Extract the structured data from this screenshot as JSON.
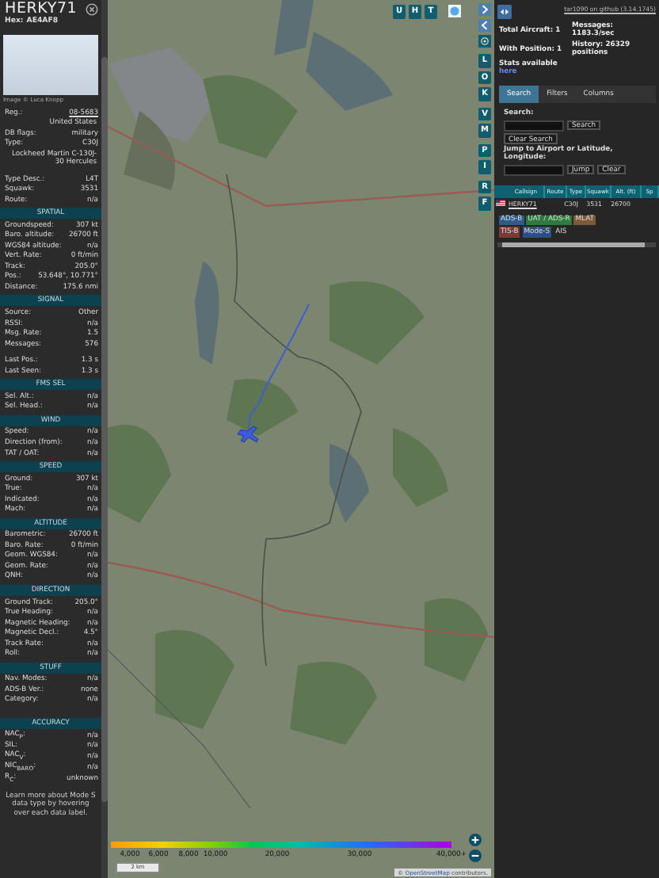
{
  "aircraft_panel": {
    "callsign": "HERKY71",
    "hex_label": "Hex:",
    "hex": "AE4AF8",
    "photo_credit": "Image © Luca Knopp",
    "details": [
      {
        "kind": "link",
        "label": "Reg.:",
        "value": "08-5683"
      },
      {
        "kind": "value",
        "value": "United States"
      },
      {
        "kind": "field",
        "label": "DB flags:",
        "value": "military"
      },
      {
        "kind": "field",
        "label": "Type:",
        "value": "C30J"
      },
      {
        "kind": "value",
        "value": "Lockheed Martin C-130J-30 Hercules"
      },
      {
        "kind": "field",
        "label": "Type Desc.:",
        "value": "L4T"
      },
      {
        "kind": "field",
        "label": "Squawk:",
        "value": "3531"
      },
      {
        "kind": "field",
        "label": "Route:",
        "value": "n/a"
      }
    ],
    "sections": [
      {
        "title": "SPATIAL",
        "rows": [
          {
            "label": "Groundspeed:",
            "value": "307 kt"
          },
          {
            "label": "Baro. altitude:",
            "value": "26700 ft"
          },
          {
            "label": "WGS84 altitude:",
            "value": "n/a"
          },
          {
            "label": "Vert. Rate:",
            "value": "0 ft/min"
          },
          {
            "label": "Track:",
            "value": "205.0°"
          },
          {
            "label": "Pos.:",
            "value": "53.648°, 10.771°"
          },
          {
            "label": "Distance:",
            "value": "175.6 nmi"
          }
        ]
      },
      {
        "title": "SIGNAL",
        "rows": [
          {
            "label": "Source:",
            "value": "Other"
          },
          {
            "label": "RSSI:",
            "value": "n/a"
          },
          {
            "label": "Msg. Rate:",
            "value": "1.5"
          },
          {
            "label": "Messages:",
            "value": "576"
          },
          {
            "label": "Last Pos.:",
            "value": "1.3 s"
          },
          {
            "label": "Last Seen:",
            "value": "1.3 s"
          }
        ]
      },
      {
        "title": "FMS SEL",
        "rows": [
          {
            "label": "Sel. Alt.:",
            "value": "n/a"
          },
          {
            "label": "Sel. Head.:",
            "value": "n/a"
          }
        ]
      },
      {
        "title": "WIND",
        "rows": [
          {
            "label": "Speed:",
            "value": "n/a"
          },
          {
            "label": "Direction (from):",
            "value": "n/a"
          },
          {
            "label": "TAT / OAT:",
            "value": "n/a"
          }
        ]
      },
      {
        "title": "SPEED",
        "rows": [
          {
            "label": "Ground:",
            "value": "307 kt"
          },
          {
            "label": "True:",
            "value": "n/a"
          },
          {
            "label": "Indicated:",
            "value": "n/a"
          },
          {
            "label": "Mach:",
            "value": "n/a"
          }
        ]
      },
      {
        "title": "ALTITUDE",
        "rows": [
          {
            "label": "Barometric:",
            "value": "26700 ft"
          },
          {
            "label": "Baro. Rate:",
            "value": "0 ft/min"
          },
          {
            "label": "Geom. WGS84:",
            "value": "n/a"
          },
          {
            "label": "Geom. Rate:",
            "value": "n/a"
          },
          {
            "label": "QNH:",
            "value": "n/a"
          }
        ]
      },
      {
        "title": "DIRECTION",
        "rows": [
          {
            "label": "Ground Track:",
            "value": "205.0°"
          },
          {
            "label": "True Heading:",
            "value": "n/a"
          },
          {
            "label": "Magnetic Heading:",
            "value": "n/a"
          },
          {
            "label": "Magnetic Decl.:",
            "value": "4.5°"
          },
          {
            "label": "Track Rate:",
            "value": "n/a"
          },
          {
            "label": "Roll:",
            "value": "n/a"
          }
        ]
      },
      {
        "title": "STUFF",
        "rows": [
          {
            "label": "Nav. Modes:",
            "value": "n/a"
          },
          {
            "label": "ADS-B Ver.:",
            "value": "none"
          },
          {
            "label": "Category:",
            "value": "n/a"
          }
        ]
      },
      {
        "title": "ACCURACY",
        "rows": [
          {
            "label": "NAC$_{P}$:",
            "value": "n/a"
          },
          {
            "label": "SIL:",
            "value": "n/a"
          },
          {
            "label": "NAC$_{V}$:",
            "value": "n/a"
          },
          {
            "label": "NIC$_{BARO}$:",
            "value": "n/a"
          },
          {
            "label": "R$_{C}$:",
            "value": "unknown"
          }
        ]
      }
    ],
    "footnote": "Learn more about Mode S data type by hovering over each data label."
  },
  "map": {
    "top_buttons": [
      "U",
      "H",
      "T"
    ],
    "side_button_groups": [
      [
        "L",
        "O",
        "K"
      ],
      [
        "V",
        "M"
      ],
      [
        "P",
        "I"
      ],
      [
        "R",
        "F"
      ]
    ],
    "legend_labels": [
      "4,000",
      "6,000",
      "8,000",
      "10,000",
      "20,000",
      "30,000",
      "40,000+"
    ],
    "scale": "2 km",
    "attribution_prefix": "©",
    "attribution_link": "OpenStreetMap",
    "attribution_suffix": "contributors."
  },
  "list_panel": {
    "version_link": "tar1090 on github (3.14.1745)",
    "stats": [
      {
        "label": "Total Aircraft:",
        "value": "1"
      },
      {
        "label": "Messages:",
        "value": "1183.3/sec"
      },
      {
        "label": "With Position:",
        "value": "1"
      },
      {
        "label": "History:",
        "value": "26329 positions"
      }
    ],
    "stats_text": "Stats available",
    "stats_link": "here",
    "tabs": [
      {
        "label": "Search",
        "selected": true
      },
      {
        "label": "Filters",
        "selected": false
      },
      {
        "label": "Columns",
        "selected": false
      }
    ],
    "search_label": "Search:",
    "search_button": "Search",
    "clear_search_button": "Clear Search",
    "jump_label": "Jump to Airport or Latitude, Longitude:",
    "jump_button": "Jump",
    "clear_button": "Clear",
    "table": {
      "columns": [
        "Callsign",
        "Route",
        "Type",
        "Squawk",
        "Alt. (ft)",
        "Sp"
      ],
      "rows": [
        {
          "callsign": "HERKY71",
          "type": "C30J",
          "squawk": "3531",
          "altitude": "26700"
        }
      ]
    },
    "source_tags": [
      {
        "label": "ADS-B",
        "color": "#2e5c86"
      },
      {
        "label": "UAT / ADS-R",
        "color": "#2f7a3c"
      },
      {
        "label": "MLAT",
        "color": "#7a5a38"
      },
      {
        "label": "TIS-B",
        "color": "#7a3a36"
      },
      {
        "label": "Mode-S",
        "color": "#2e4f86"
      },
      {
        "label": "AIS",
        "color": "#262626"
      }
    ]
  }
}
